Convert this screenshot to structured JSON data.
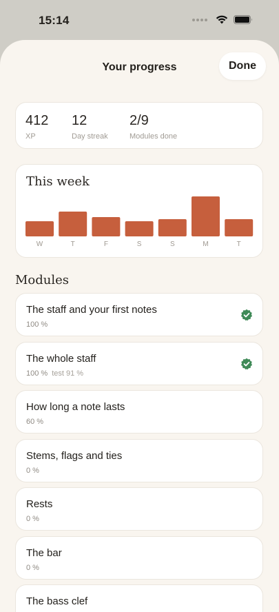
{
  "status_bar": {
    "time": "15:14"
  },
  "header": {
    "title": "Your progress",
    "done_label": "Done"
  },
  "stats": [
    {
      "value": "412",
      "label": "XP"
    },
    {
      "value": "12",
      "label": "Day streak"
    },
    {
      "value": "2/9",
      "label": "Modules done"
    }
  ],
  "week": {
    "title": "This week",
    "bar_color": "#c65f3d"
  },
  "chart_data": {
    "type": "bar",
    "categories": [
      "W",
      "T",
      "F",
      "S",
      "S",
      "M",
      "T"
    ],
    "values": [
      22,
      36,
      28,
      22,
      25,
      58,
      25
    ],
    "title": "This week",
    "xlabel": "",
    "ylabel": "",
    "ylim": [
      0,
      60
    ],
    "grid": false
  },
  "modules_heading": "Modules",
  "modules": [
    {
      "title": "The staff and your first notes",
      "progress": "100 %",
      "test": "",
      "done": true
    },
    {
      "title": "The whole staff",
      "progress": "100 %",
      "test": "test 91 %",
      "done": true
    },
    {
      "title": "How long a note lasts",
      "progress": "60 %",
      "test": "",
      "done": false
    },
    {
      "title": "Stems, flags and ties",
      "progress": "0 %",
      "test": "",
      "done": false
    },
    {
      "title": "Rests",
      "progress": "0 %",
      "test": "",
      "done": false
    },
    {
      "title": "The bar",
      "progress": "0 %",
      "test": "",
      "done": false
    },
    {
      "title": "The bass clef",
      "progress": "",
      "test": "",
      "done": false
    }
  ],
  "colors": {
    "check": "#3f8a57",
    "sheet_bg": "#f9f5ef",
    "backdrop": "#cfcdc6"
  }
}
